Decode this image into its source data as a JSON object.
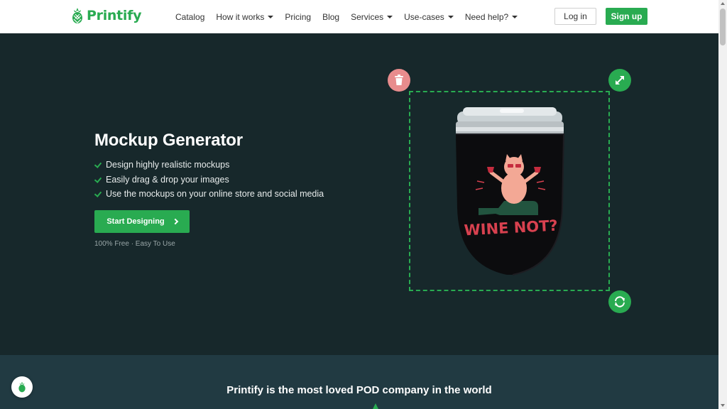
{
  "header": {
    "logo_text": "Printify",
    "nav": [
      {
        "label": "Catalog",
        "dropdown": false
      },
      {
        "label": "How it works",
        "dropdown": true
      },
      {
        "label": "Pricing",
        "dropdown": false
      },
      {
        "label": "Blog",
        "dropdown": false
      },
      {
        "label": "Services",
        "dropdown": true
      },
      {
        "label": "Use-cases",
        "dropdown": true
      },
      {
        "label": "Need help?",
        "dropdown": true
      }
    ],
    "login_label": "Log in",
    "signup_label": "Sign up"
  },
  "hero": {
    "title": "Mockup Generator",
    "bullets": [
      "Design highly realistic mockups",
      "Easily drag & drop your images",
      "Use the mockups on your online store and social media"
    ],
    "cta_label": "Start Designing",
    "subtext": "100% Free · Easy To Use"
  },
  "editor": {
    "product_art_text": "WINE NOT?",
    "delete_icon": "trash-icon",
    "resize_icon": "expand-arrows-icon",
    "rotate_icon": "rotate-arrows-icon"
  },
  "section2": {
    "title": "Printify is the most loved POD company in the world"
  },
  "colors": {
    "brand_green": "#29ab51",
    "hero_bg": "#17282b",
    "section2_bg": "#213a42",
    "delete_pink": "#e88c8d"
  }
}
